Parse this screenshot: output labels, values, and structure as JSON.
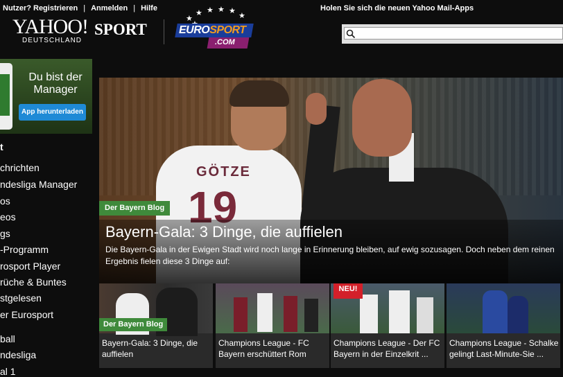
{
  "topbar": {
    "links": [
      "Nutzer? Registrieren",
      "Anmelden",
      "Hilfe"
    ],
    "mail_apps": "Holen Sie sich die neuen Yahoo Mail-Apps"
  },
  "logo": {
    "yahoo": "YAHOO!",
    "sport": "SPORT",
    "country": "DEUTSCHLAND",
    "eurosport_euro": "EURO",
    "eurosport_sport": "SPORT",
    "eurosport_com": ".COM"
  },
  "search": {
    "placeholder": ""
  },
  "promo": {
    "title": "Du bist der Manager",
    "button": "App herunterladen"
  },
  "nav": {
    "items": [
      "t",
      "chrichten",
      "ndesliga Manager",
      "os",
      "eos",
      "gs",
      "-Programm",
      "rosport Player",
      "rüche & Buntes",
      "stgelesen",
      "er Eurosport",
      "ball",
      "ndesliga",
      "al 1"
    ]
  },
  "hero": {
    "badge": "Der Bayern Blog",
    "title": "Bayern-Gala: 3 Dinge, die auffielen",
    "description": "Die Bayern-Gala in der Ewigen Stadt wird noch lange in Erinnerung bleiben, auf ewig sozusagen. Doch neben dem reinen Ergebnis fielen diese 3 Dinge auf:",
    "shirt_name": "GÖTZE",
    "shirt_number": "19"
  },
  "thumbs": [
    {
      "badge": "Der Bayern Blog",
      "caption": "Bayern-Gala: 3 Dinge, die auffielen"
    },
    {
      "badge": "",
      "caption": "Champions League - FC Bayern erschüttert Rom"
    },
    {
      "badge": "NEU!",
      "caption": "Champions League - Der FC Bayern in der Einzelkrit ..."
    },
    {
      "badge": "",
      "caption": "Champions League - Schalke gelingt Last-Minute-Sie ..."
    }
  ],
  "colors": {
    "background": "#0d0d0d",
    "badge_green": "#3f8a3b",
    "promo_button": "#1f8ad6",
    "neu_red": "#d3202a"
  }
}
